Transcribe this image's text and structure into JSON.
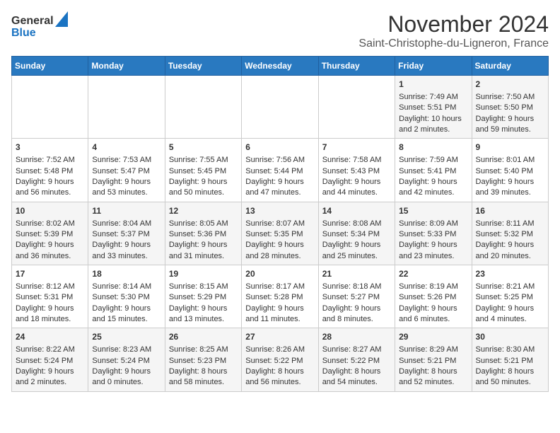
{
  "header": {
    "logo_general": "General",
    "logo_blue": "Blue",
    "title": "November 2024",
    "subtitle": "Saint-Christophe-du-Ligneron, France"
  },
  "calendar": {
    "days_of_week": [
      "Sunday",
      "Monday",
      "Tuesday",
      "Wednesday",
      "Thursday",
      "Friday",
      "Saturday"
    ],
    "weeks": [
      [
        {
          "day": "",
          "content": ""
        },
        {
          "day": "",
          "content": ""
        },
        {
          "day": "",
          "content": ""
        },
        {
          "day": "",
          "content": ""
        },
        {
          "day": "",
          "content": ""
        },
        {
          "day": "1",
          "content": "Sunrise: 7:49 AM\nSunset: 5:51 PM\nDaylight: 10 hours\nand 2 minutes."
        },
        {
          "day": "2",
          "content": "Sunrise: 7:50 AM\nSunset: 5:50 PM\nDaylight: 9 hours\nand 59 minutes."
        }
      ],
      [
        {
          "day": "3",
          "content": "Sunrise: 7:52 AM\nSunset: 5:48 PM\nDaylight: 9 hours\nand 56 minutes."
        },
        {
          "day": "4",
          "content": "Sunrise: 7:53 AM\nSunset: 5:47 PM\nDaylight: 9 hours\nand 53 minutes."
        },
        {
          "day": "5",
          "content": "Sunrise: 7:55 AM\nSunset: 5:45 PM\nDaylight: 9 hours\nand 50 minutes."
        },
        {
          "day": "6",
          "content": "Sunrise: 7:56 AM\nSunset: 5:44 PM\nDaylight: 9 hours\nand 47 minutes."
        },
        {
          "day": "7",
          "content": "Sunrise: 7:58 AM\nSunset: 5:43 PM\nDaylight: 9 hours\nand 44 minutes."
        },
        {
          "day": "8",
          "content": "Sunrise: 7:59 AM\nSunset: 5:41 PM\nDaylight: 9 hours\nand 42 minutes."
        },
        {
          "day": "9",
          "content": "Sunrise: 8:01 AM\nSunset: 5:40 PM\nDaylight: 9 hours\nand 39 minutes."
        }
      ],
      [
        {
          "day": "10",
          "content": "Sunrise: 8:02 AM\nSunset: 5:39 PM\nDaylight: 9 hours\nand 36 minutes."
        },
        {
          "day": "11",
          "content": "Sunrise: 8:04 AM\nSunset: 5:37 PM\nDaylight: 9 hours\nand 33 minutes."
        },
        {
          "day": "12",
          "content": "Sunrise: 8:05 AM\nSunset: 5:36 PM\nDaylight: 9 hours\nand 31 minutes."
        },
        {
          "day": "13",
          "content": "Sunrise: 8:07 AM\nSunset: 5:35 PM\nDaylight: 9 hours\nand 28 minutes."
        },
        {
          "day": "14",
          "content": "Sunrise: 8:08 AM\nSunset: 5:34 PM\nDaylight: 9 hours\nand 25 minutes."
        },
        {
          "day": "15",
          "content": "Sunrise: 8:09 AM\nSunset: 5:33 PM\nDaylight: 9 hours\nand 23 minutes."
        },
        {
          "day": "16",
          "content": "Sunrise: 8:11 AM\nSunset: 5:32 PM\nDaylight: 9 hours\nand 20 minutes."
        }
      ],
      [
        {
          "day": "17",
          "content": "Sunrise: 8:12 AM\nSunset: 5:31 PM\nDaylight: 9 hours\nand 18 minutes."
        },
        {
          "day": "18",
          "content": "Sunrise: 8:14 AM\nSunset: 5:30 PM\nDaylight: 9 hours\nand 15 minutes."
        },
        {
          "day": "19",
          "content": "Sunrise: 8:15 AM\nSunset: 5:29 PM\nDaylight: 9 hours\nand 13 minutes."
        },
        {
          "day": "20",
          "content": "Sunrise: 8:17 AM\nSunset: 5:28 PM\nDaylight: 9 hours\nand 11 minutes."
        },
        {
          "day": "21",
          "content": "Sunrise: 8:18 AM\nSunset: 5:27 PM\nDaylight: 9 hours\nand 8 minutes."
        },
        {
          "day": "22",
          "content": "Sunrise: 8:19 AM\nSunset: 5:26 PM\nDaylight: 9 hours\nand 6 minutes."
        },
        {
          "day": "23",
          "content": "Sunrise: 8:21 AM\nSunset: 5:25 PM\nDaylight: 9 hours\nand 4 minutes."
        }
      ],
      [
        {
          "day": "24",
          "content": "Sunrise: 8:22 AM\nSunset: 5:24 PM\nDaylight: 9 hours\nand 2 minutes."
        },
        {
          "day": "25",
          "content": "Sunrise: 8:23 AM\nSunset: 5:24 PM\nDaylight: 9 hours\nand 0 minutes."
        },
        {
          "day": "26",
          "content": "Sunrise: 8:25 AM\nSunset: 5:23 PM\nDaylight: 8 hours\nand 58 minutes."
        },
        {
          "day": "27",
          "content": "Sunrise: 8:26 AM\nSunset: 5:22 PM\nDaylight: 8 hours\nand 56 minutes."
        },
        {
          "day": "28",
          "content": "Sunrise: 8:27 AM\nSunset: 5:22 PM\nDaylight: 8 hours\nand 54 minutes."
        },
        {
          "day": "29",
          "content": "Sunrise: 8:29 AM\nSunset: 5:21 PM\nDaylight: 8 hours\nand 52 minutes."
        },
        {
          "day": "30",
          "content": "Sunrise: 8:30 AM\nSunset: 5:21 PM\nDaylight: 8 hours\nand 50 minutes."
        }
      ]
    ]
  }
}
